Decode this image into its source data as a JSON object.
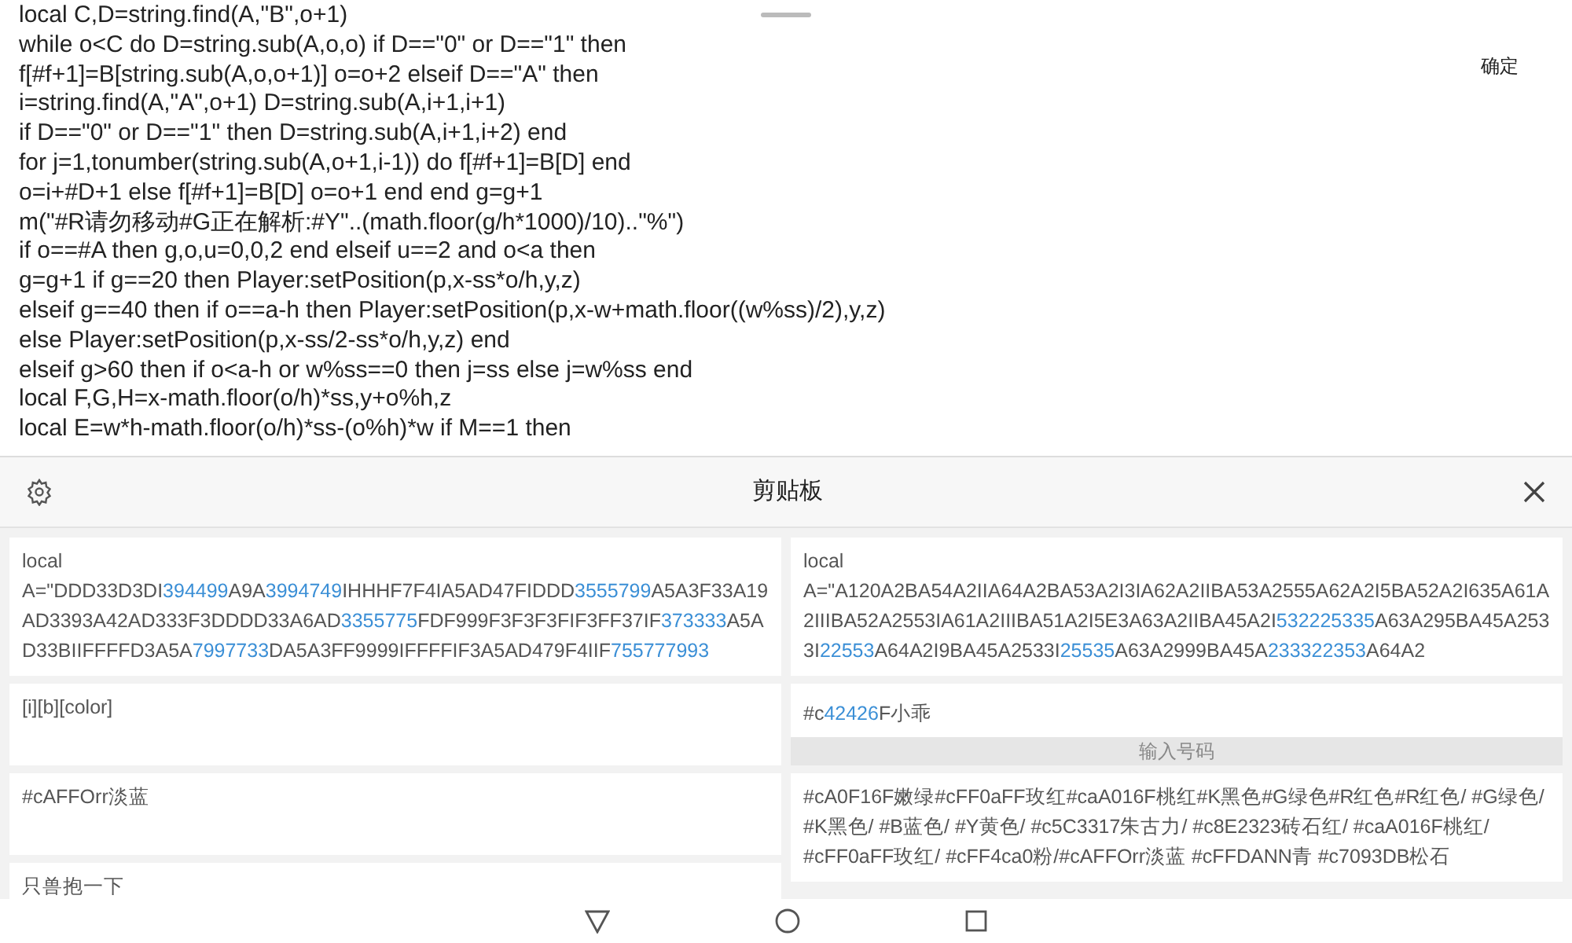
{
  "editor": {
    "lines": [
      "local C,D=string.find(A,\"B\",o+1)",
      "while o<C do D=string.sub(A,o,o) if D==\"0\" or D==\"1\" then",
      "f[#f+1]=B[string.sub(A,o,o+1)] o=o+2 elseif D==\"A\" then",
      "i=string.find(A,\"A\",o+1) D=string.sub(A,i+1,i+1)",
      "if D==\"0\" or D==\"1\" then D=string.sub(A,i+1,i+2) end",
      "for j=1,tonumber(string.sub(A,o+1,i-1)) do f[#f+1]=B[D] end",
      "o=i+#D+1 else f[#f+1]=B[D] o=o+1 end end g=g+1",
      "m(\"#R请勿移动#G正在解析:#Y\"..(math.floor(g/h*1000)/10)..\"%\")",
      "if o==#A then g,o,u=0,0,2 end elseif u==2 and o<a then",
      "g=g+1 if g==20 then Player:setPosition(p,x-ss*o/h,y,z)",
      "elseif g==40 then if o==a-h then Player:setPosition(p,x-w+math.floor((w%ss)/2),y,z)",
      "else Player:setPosition(p,x-ss/2-ss*o/h,y,z) end",
      "elseif g>60 then if o<a-h or w%ss==0 then j=ss else j=w%ss end",
      "local F,G,H=x-math.floor(o/h)*ss,y+o%h,z",
      "local E=w*h-math.floor(o/h)*ss-(o%h)*w if M==1 then"
    ],
    "confirm": "确定"
  },
  "clipboard": {
    "title": "剪贴板",
    "columns": [
      [
        {
          "parts": [
            {
              "text": "local A=\"DDD33D3DI",
              "highlight": false
            },
            {
              "text": "394499",
              "highlight": true
            },
            {
              "text": "A9A",
              "highlight": false
            },
            {
              "text": "3994749",
              "highlight": true
            },
            {
              "text": "IHHHF7F4IA5AD47FIDDD",
              "highlight": false
            },
            {
              "text": "3555799",
              "highlight": true
            },
            {
              "text": "A5A3F33A19AD3393A42AD333F3DDDD33A6AD",
              "highlight": false
            },
            {
              "text": "3355775",
              "highlight": true
            },
            {
              "text": "FDF999F3F3F3FIF3FF37IF",
              "highlight": false
            },
            {
              "text": "373333",
              "highlight": true
            },
            {
              "text": "A5AD33BIIFFFFD3A5A",
              "highlight": false
            },
            {
              "text": "7997733",
              "highlight": true
            },
            {
              "text": "DA5A3FF9999IFFFFIF3A5AD479F4IIF",
              "highlight": false
            },
            {
              "text": "755777993",
              "highlight": true
            }
          ]
        },
        {
          "parts": [
            {
              "text": "[i][b][color]",
              "highlight": false
            }
          ]
        },
        {
          "parts": [
            {
              "text": "#cAFFOrr淡蓝",
              "highlight": false
            }
          ]
        },
        {
          "parts": [
            {
              "text": "只兽抱一下",
              "highlight": false
            }
          ]
        }
      ],
      [
        {
          "parts": [
            {
              "text": "local A=\"A120A2BA54A2IIA64A2BA53A2I3IA62A2IIBA53A2555A62A2I5BA52A2I635A61A2IIIBA52A2553IA61A2IIIBA51A2I5E3A63A2IIBA45A2I",
              "highlight": false
            },
            {
              "text": "532225335",
              "highlight": true
            },
            {
              "text": "A63A295BA45A2533I",
              "highlight": false
            },
            {
              "text": "22553",
              "highlight": true
            },
            {
              "text": "A64A2I9BA45A2533I",
              "highlight": false
            },
            {
              "text": "25535",
              "highlight": true
            },
            {
              "text": "A63A2999BA45A",
              "highlight": false
            },
            {
              "text": "233322353",
              "highlight": true
            },
            {
              "text": "A64A2",
              "highlight": false
            }
          ]
        },
        {
          "parts": [
            {
              "text": "#c",
              "highlight": false
            },
            {
              "text": "42426",
              "highlight": true
            },
            {
              "text": "F小乖",
              "highlight": false
            }
          ],
          "action": "输入号码"
        },
        {
          "parts": [
            {
              "text": "#cA0F16F嫩绿#cFF0aFF玫红#caA016F桃红#K黑色#G绿色#R红色#R红色/ #G绿色/ #K黑色/ #B蓝色/ #Y黄色/ #c5C3317朱古力/ #c8E2323砖石红/ #caA016F桃红/ #cFF0aFF玫红/ #cFF4ca0粉/#cAFFOrr淡蓝 #cFFDANN青 #c7093DB松石",
              "highlight": false
            }
          ]
        }
      ]
    ]
  }
}
